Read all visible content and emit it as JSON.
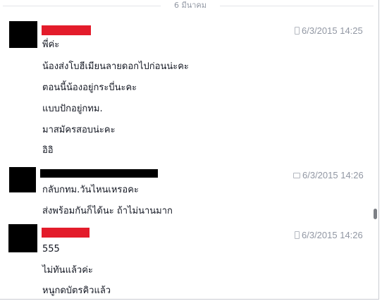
{
  "date_divider": "6 มีนาคม",
  "scrollbar": "scrollbar",
  "messages": [
    {
      "sender_redacted_color": "#e31c2b",
      "timestamp": "6/3/2015 14:25",
      "source_icon": "mobile-phone-icon",
      "lines": [
        "พี่ค่ะ",
        "น้องส่งโบฮีเมียนลายดอกไปก่อนน่ะคะ",
        "ตอนนี้น้องอยู่กระบี่นะคะ",
        "แบบปักอยู่กทม.",
        "มาสมัครสอบน่ะคะ",
        "อิอิ"
      ]
    },
    {
      "sender_redacted_color": "#000000",
      "timestamp": "6/3/2015 14:26",
      "source_icon": "chat-bubble-icon",
      "lines": [
        "กลับกทม.วันไหนเหรอคะ",
        "ส่งพร้อมกันก็ได้นะ ถ้าไม่นานมาก"
      ]
    },
    {
      "sender_redacted_color": "#e31c2b",
      "timestamp": "6/3/2015 14:26",
      "source_icon": "mobile-phone-icon",
      "lines": [
        "555",
        "ไม่ทันแล้วค่ะ",
        "หนูกดบัตรคิวแล้ว"
      ]
    }
  ]
}
